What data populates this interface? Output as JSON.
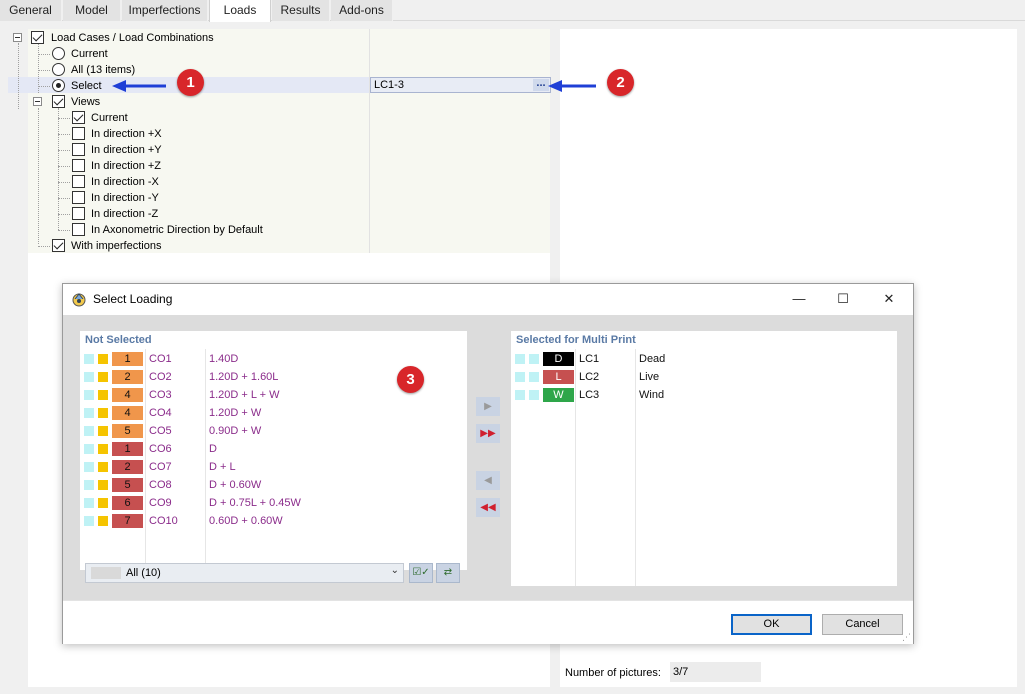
{
  "tabs": [
    {
      "label": "General",
      "active": false
    },
    {
      "label": "Model",
      "active": false
    },
    {
      "label": "Imperfections",
      "active": false
    },
    {
      "label": "Loads",
      "active": true
    },
    {
      "label": "Results",
      "active": false
    },
    {
      "label": "Add-ons",
      "active": false
    }
  ],
  "tree": {
    "load_cases_group": "Load Cases / Load Combinations",
    "current": "Current",
    "all": "All (13 items)",
    "select": "Select",
    "select_value": "LC1-3",
    "ellipsis": "...",
    "views_group": "Views",
    "views": [
      {
        "label": "Current",
        "checked": true
      },
      {
        "label": "In direction +X",
        "checked": false
      },
      {
        "label": "In direction +Y",
        "checked": false
      },
      {
        "label": "In direction +Z",
        "checked": false
      },
      {
        "label": "In direction -X",
        "checked": false
      },
      {
        "label": "In direction -Y",
        "checked": false
      },
      {
        "label": "In direction -Z",
        "checked": false
      },
      {
        "label": "In Axonometric Direction by Default",
        "checked": false
      }
    ],
    "with_imperfections": "With imperfections"
  },
  "number_of_pictures": {
    "label": "Number of pictures:",
    "value": "3/7"
  },
  "annotations": [
    "1",
    "2",
    "3"
  ],
  "dialog": {
    "title": "Select Loading",
    "minimize": "—",
    "maximize": "☐",
    "close": "✕",
    "not_selected": {
      "header": "Not Selected",
      "rows": [
        {
          "num": "1",
          "name": "CO1",
          "def": "1.40D",
          "color": "#f0964b"
        },
        {
          "num": "2",
          "name": "CO2",
          "def": "1.20D + 1.60L",
          "color": "#f0964b"
        },
        {
          "num": "4",
          "name": "CO3",
          "def": "1.20D + L + W",
          "color": "#f0964b"
        },
        {
          "num": "4",
          "name": "CO4",
          "def": "1.20D + W",
          "color": "#f0964b"
        },
        {
          "num": "5",
          "name": "CO5",
          "def": "0.90D + W",
          "color": "#f0964b"
        },
        {
          "num": "1",
          "name": "CO6",
          "def": "D",
          "color": "#c65050"
        },
        {
          "num": "2",
          "name": "CO7",
          "def": "D + L",
          "color": "#c65050"
        },
        {
          "num": "5",
          "name": "CO8",
          "def": "D + 0.60W",
          "color": "#c65050"
        },
        {
          "num": "6",
          "name": "CO9",
          "def": "D + 0.75L + 0.45W",
          "color": "#c65050"
        },
        {
          "num": "7",
          "name": "CO10",
          "def": "0.60D + 0.60W",
          "color": "#c65050"
        }
      ],
      "filter_value": "All (10)"
    },
    "selected": {
      "header": "Selected for Multi Print",
      "rows": [
        {
          "chip": "D",
          "name": "LC1",
          "desc": "Dead",
          "color": "#000000",
          "text_color": "#ffffff"
        },
        {
          "chip": "L",
          "name": "LC2",
          "desc": "Live",
          "color": "#c65050",
          "text_color": "#ffffff"
        },
        {
          "chip": "W",
          "name": "LC3",
          "desc": "Wind",
          "color": "#2ea64a",
          "text_color": "#ffffff"
        }
      ]
    },
    "move_buttons": {
      "right": "▶",
      "all_right": "▶▶",
      "left": "◀",
      "all_left": "◀◀"
    },
    "ok": "OK",
    "cancel": "Cancel"
  },
  "colors": {
    "accent": "#0a64c8",
    "badge": "#d8262a",
    "arrow": "#1f3fd6",
    "tree_background": "#f7f8f1",
    "combination_text": "#8b2c8b",
    "list_header": "#5a7aa5",
    "cyan_swatch": "#bff2f5",
    "yellow_swatch": "#f5c400"
  }
}
